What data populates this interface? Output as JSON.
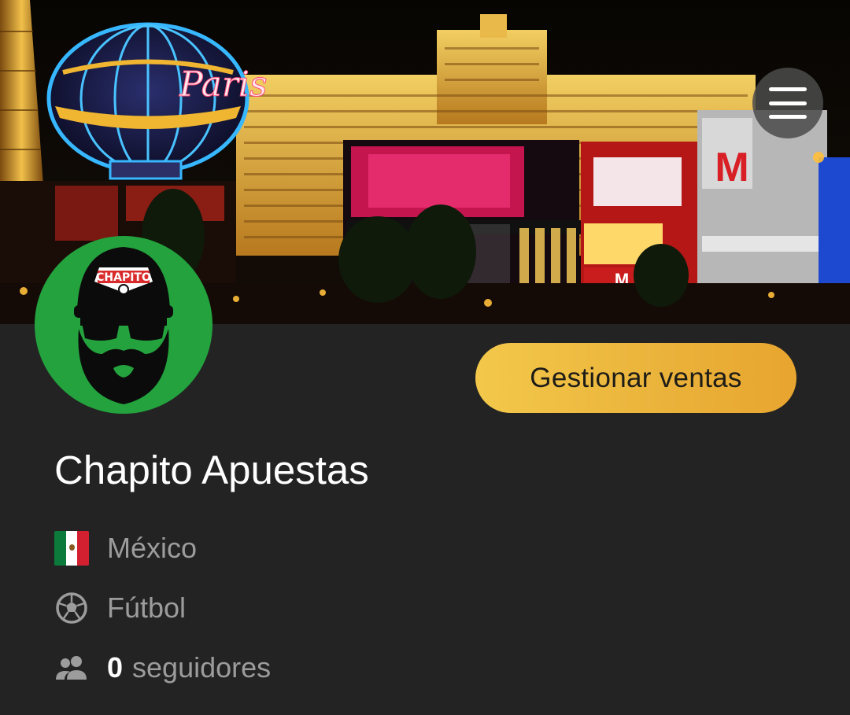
{
  "header": {
    "menu_icon": "hamburger-menu-icon",
    "cover_image": "las-vegas-strip-night-photo"
  },
  "profile": {
    "avatar": "chapito-bearded-man-avatar",
    "avatar_logo_text": "CHAPITO",
    "name": "Chapito Apuestas",
    "manage_button_label": "Gestionar ventas",
    "country": "México",
    "country_icon": "mexico-flag-icon",
    "sport": "Fútbol",
    "sport_icon": "soccer-ball-icon",
    "followers_count": "0",
    "followers_label": "seguidores",
    "followers_icon": "people-icon"
  },
  "colors": {
    "background": "#232323",
    "button_gold": "#eab23a",
    "avatar_green": "#23a23d"
  }
}
